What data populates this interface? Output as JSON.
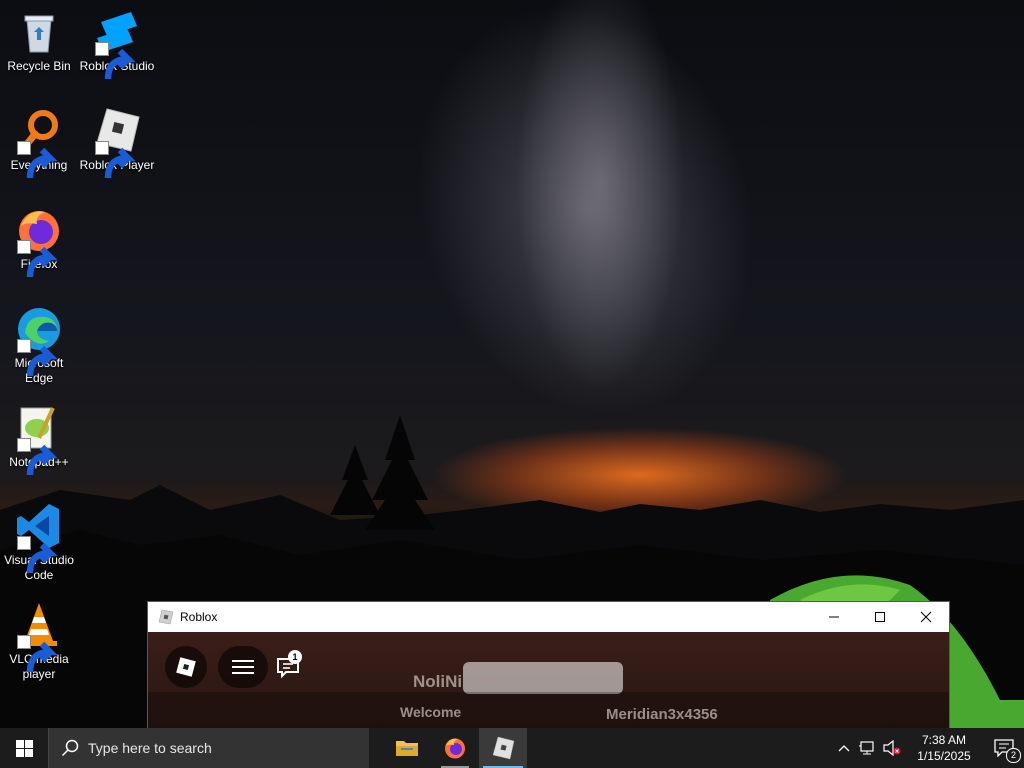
{
  "desktop": {
    "icons": [
      {
        "label": "Recycle Bin"
      },
      {
        "label": "Roblox Studio"
      },
      {
        "label": "Everything"
      },
      {
        "label": "Roblox Player"
      },
      {
        "label": "Firefox"
      },
      {
        "label": "Microsoft Edge"
      },
      {
        "label": "Notepad++"
      },
      {
        "label": "Visual Studio Code"
      },
      {
        "label": "VLC media player"
      }
    ]
  },
  "window": {
    "title": "Roblox",
    "chat_badge": "1",
    "game_texts": [
      "NoliNi",
      "Welcome",
      "Meridian3x4356"
    ]
  },
  "taskbar": {
    "search_placeholder": "Type here to search",
    "apps": [
      "file-explorer",
      "firefox",
      "roblox"
    ],
    "clock_time": "7:38 AM",
    "clock_date": "1/15/2025",
    "notification_count": "2"
  },
  "colors": {
    "taskbar_bg": "#1c1c1c",
    "active_underline": "#76b9ed",
    "titlebar_bg": "#ffffff"
  }
}
